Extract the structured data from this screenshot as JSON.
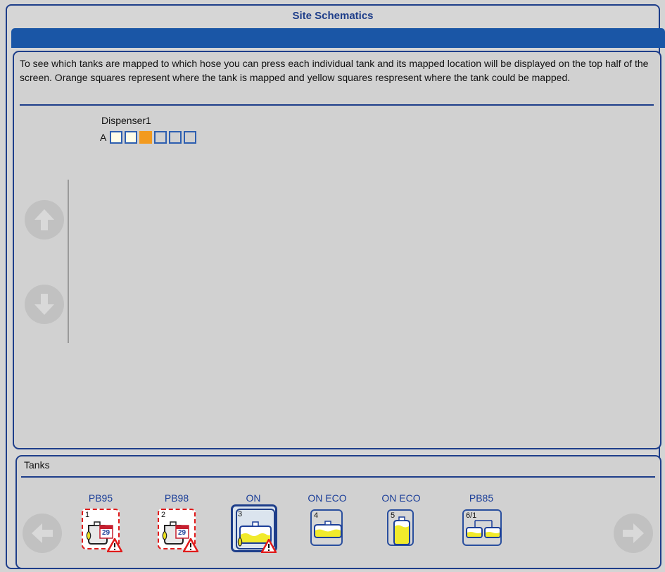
{
  "window": {
    "title": "Site Schematics"
  },
  "instructions": "To see which tanks are mapped to which hose you can press each individual tank and its mapped location will be displayed on the top half of the screen. Orange squares represent where the tank is mapped and yellow squares respresent where the tank could be mapped.",
  "dispenser": {
    "name": "Dispenser1",
    "hose_letter": "A",
    "positions": [
      "light",
      "light",
      "mapped",
      "empty",
      "empty",
      "empty"
    ]
  },
  "navigation": {
    "up_icon": "arrow-up-circle-icon",
    "down_icon": "arrow-down-circle-icon",
    "left_icon": "arrow-left-circle-icon",
    "right_icon": "arrow-right-circle-icon"
  },
  "tanks": {
    "label": "Tanks",
    "items": [
      {
        "name": "PB95",
        "number": "1",
        "calendar_day": "29",
        "icon": "tank-delivery-calendar-icon",
        "alarm": true,
        "warning": true,
        "selected": false
      },
      {
        "name": "PB98",
        "number": "2",
        "calendar_day": "29",
        "icon": "tank-delivery-calendar-icon",
        "alarm": true,
        "warning": true,
        "selected": false
      },
      {
        "name": "ON",
        "number": "3",
        "icon": "tank-leak-icon",
        "alarm": false,
        "warning": true,
        "selected": true
      },
      {
        "name": "ON ECO",
        "number": "4",
        "icon": "tank-icon",
        "alarm": false,
        "warning": false,
        "selected": false
      },
      {
        "name": "ON ECO",
        "number": "5",
        "icon": "vertical-tank-icon",
        "alarm": false,
        "warning": false,
        "selected": false
      },
      {
        "name": "PB85",
        "number": "6/1",
        "icon": "manifold-tanks-icon",
        "alarm": false,
        "warning": false,
        "selected": false
      }
    ]
  },
  "colors": {
    "frame_blue": "#1e3e8a",
    "title_bar": "#1a56a6",
    "mapped_orange": "#f29a1f",
    "possible_yellow": "#fffde8",
    "alarm_red": "#e01a1a",
    "fuel_yellow": "#f1ea2c"
  }
}
